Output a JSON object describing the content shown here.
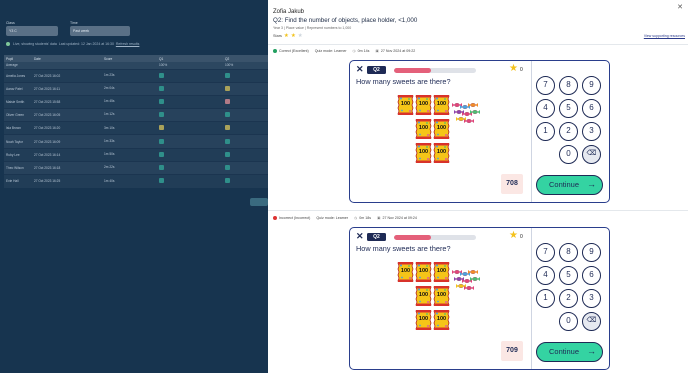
{
  "background": {
    "filters": [
      {
        "label": "Class",
        "value": "Y3 C"
      },
      {
        "label": "Time",
        "value": "Past week"
      }
    ],
    "status": {
      "text": "Live, showing students' data",
      "updated": "Last updated: 12 Jan 2024 at 16:30",
      "link": "Refresh results"
    },
    "table": {
      "headers": [
        "Pupil",
        "Date",
        "Score",
        "Q1",
        "Q2"
      ],
      "average_row": {
        "label": "Average",
        "q1": "100%",
        "q2": "100%"
      },
      "rows": [
        {
          "name": "Amelia Jones",
          "date": "27 Oct 2023 16:02",
          "time": "1m 23s",
          "q1": "g",
          "q2": "g"
        },
        {
          "name": "Aarav Patel",
          "date": "27 Oct 2023 16:11",
          "time": "2m 04s",
          "q1": "g",
          "q2": "y"
        },
        {
          "name": "Maisie Smith",
          "date": "27 Oct 2023 15:58",
          "time": "1m 45s",
          "q1": "g",
          "q2": "r"
        },
        {
          "name": "Oliver Green",
          "date": "27 Oct 2023 16:05",
          "time": "1m 12s",
          "q1": "g",
          "q2": "g"
        },
        {
          "name": "Isla Brown",
          "date": "27 Oct 2023 16:20",
          "time": "3m 10s",
          "q1": "y",
          "q2": "y"
        },
        {
          "name": "Noah Taylor",
          "date": "27 Oct 2023 16:09",
          "time": "1m 33s",
          "q1": "g",
          "q2": "g"
        },
        {
          "name": "Ruby Lee",
          "date": "27 Oct 2023 16:14",
          "time": "1m 50s",
          "q1": "g",
          "q2": "g"
        },
        {
          "name": "Theo Wilson",
          "date": "27 Oct 2023 16:18",
          "time": "2m 22s",
          "q1": "g",
          "q2": "g"
        },
        {
          "name": "Evie Hall",
          "date": "27 Oct 2023 16:25",
          "time": "1m 40s",
          "q1": "g",
          "q2": "g"
        }
      ]
    }
  },
  "panel": {
    "close_icon": "close-icon",
    "student_name": "Zofia Jakub",
    "question_title": "Q2: Find the number of objects, place holder, <1,000",
    "question_meta": "Year 3 | Place value | Represent numbers to 1,000",
    "score_label": "Stars",
    "stars": [
      true,
      true,
      false
    ],
    "view_link": "View supporting resources",
    "attempts": [
      {
        "status": "Correct (Excellent)",
        "status_kind": "correct",
        "mode": "Quiz mode: Learner",
        "duration": "0m 14s",
        "date": "27 Nov 2024 at 09:22",
        "card": {
          "close_icon": "close-icon",
          "q_badge": "Q2",
          "progress": 0.45,
          "star_count": "0",
          "prompt": "How many sweets are there?",
          "pack_label": "100",
          "answer": "708",
          "keys": [
            "7",
            "8",
            "9",
            "4",
            "5",
            "6",
            "1",
            "2",
            "3",
            "0",
            "⌫"
          ],
          "continue_label": "Continue",
          "continue_icon": "arrow-right-icon"
        }
      },
      {
        "status": "Incorrect (Incorrect)",
        "status_kind": "incorrect",
        "mode": "Quiz mode: Learner",
        "duration": "0m 18s",
        "date": "27 Nov 2024 at 09:24",
        "card": {
          "close_icon": "close-icon",
          "q_badge": "Q2",
          "progress": 0.45,
          "star_count": "0",
          "prompt": "How many sweets are there?",
          "pack_label": "100",
          "answer": "709",
          "keys": [
            "7",
            "8",
            "9",
            "4",
            "5",
            "6",
            "1",
            "2",
            "3",
            "0",
            "⌫"
          ],
          "continue_label": "Continue",
          "continue_icon": "arrow-right-icon"
        }
      }
    ]
  },
  "colors": {
    "navy": "#1e2a55",
    "continue_green": "#34d3a2",
    "progress_pink": "#e4607a",
    "star_yellow": "#f4c21c",
    "answer_bg": "#fbe7e4",
    "overlay_bg": "#17344f"
  }
}
